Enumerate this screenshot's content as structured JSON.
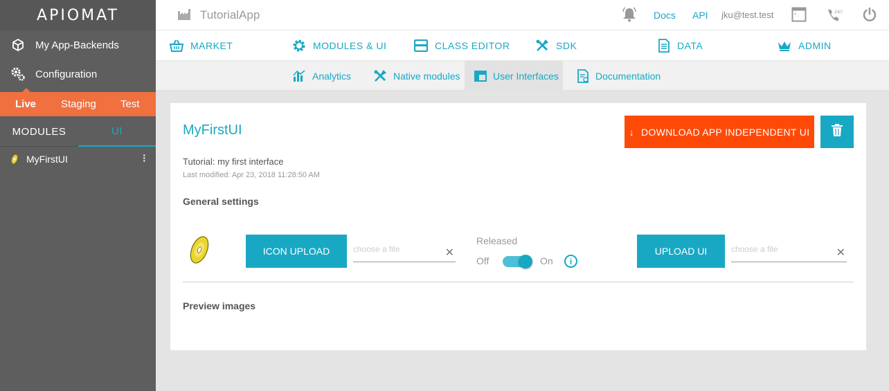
{
  "app": {
    "logo": "APIOMAT",
    "name": "TutorialApp"
  },
  "topbar": {
    "docs": "Docs",
    "api": "API",
    "user": "jku@test.test",
    "icons": [
      "bell-icon",
      "terminal-icon",
      "support-24-7-icon",
      "power-icon"
    ]
  },
  "sidebar": {
    "items": [
      {
        "label": "My App-Backends",
        "icon": "cube-icon"
      },
      {
        "label": "Configuration",
        "icon": "gears-icon"
      }
    ],
    "stages": [
      "Live",
      "Staging",
      "Test"
    ],
    "active_stage": "Live",
    "module_tabs": [
      "MODULES",
      "UI"
    ],
    "active_module_tab": "UI",
    "ui_list": [
      {
        "label": "MyFirstUI",
        "icon": "disc-icon"
      }
    ]
  },
  "nav": {
    "items": [
      {
        "label": "MARKET",
        "icon": "basket-icon"
      },
      {
        "label": "MODULES & UI",
        "icon": "gear-icon"
      },
      {
        "label": "CLASS EDITOR",
        "icon": "class-icon"
      },
      {
        "label": "SDK",
        "icon": "tools-icon"
      },
      {
        "label": "DATA",
        "icon": "document-icon"
      },
      {
        "label": "ADMIN",
        "icon": "crown-icon"
      }
    ],
    "active": "MODULES & UI"
  },
  "subnav": {
    "items": [
      {
        "label": "Analytics",
        "icon": "chart-icon"
      },
      {
        "label": "Native modules",
        "icon": "tools-icon"
      },
      {
        "label": "User Interfaces",
        "icon": "layout-icon"
      },
      {
        "label": "Documentation",
        "icon": "doc-icon"
      }
    ],
    "active": "User Interfaces"
  },
  "ui_detail": {
    "title": "MyFirstUI",
    "description": "Tutorial: my first interface",
    "last_modified": "Last modified: Apr 23, 2018 11:28:50 AM",
    "download_label": "DOWNLOAD APP INDEPENDENT UI",
    "general_settings": "General settings",
    "icon_upload_label": "ICON UPLOAD",
    "icon_file_placeholder": "choose a file",
    "released_label": "Released",
    "toggle_off": "Off",
    "toggle_on": "On",
    "released": true,
    "upload_ui_label": "UPLOAD UI",
    "ui_file_placeholder": "choose a file",
    "preview_images": "Preview images"
  },
  "colors": {
    "teal": "#18a8c4",
    "orange": "#f07040",
    "red_orange": "#fe4a08",
    "sidebar": "#5e5e5e"
  }
}
